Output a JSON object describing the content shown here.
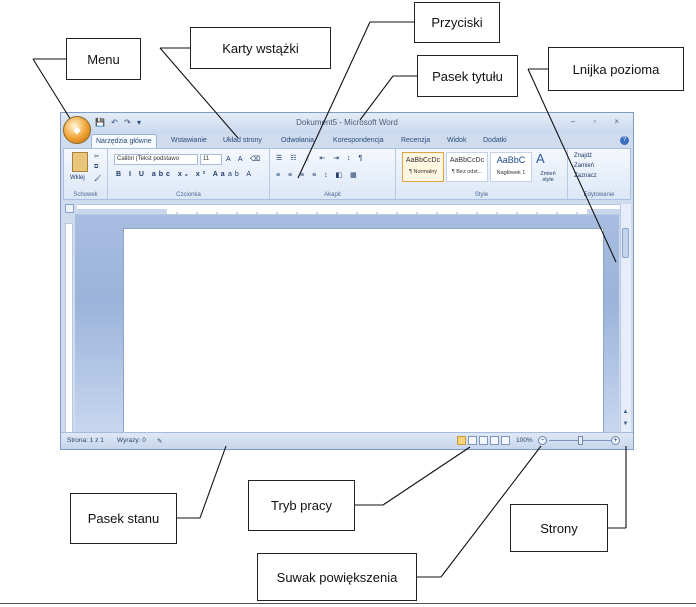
{
  "callouts": {
    "menu": "Menu",
    "karty": "Karty wstążki",
    "przyciski": "Przyciski",
    "pasek_tytulu": "Pasek tytułu",
    "linijka": "Lnijka pozioma",
    "pasek_stanu": "Pasek stanu",
    "tryb_pracy": "Tryb pracy",
    "suwak": "Suwak powiększenia",
    "strony": "Strony"
  },
  "word": {
    "title": "Dokument5 - Microsoft Word",
    "window_controls": "–  ▫  ×",
    "tabs": [
      "Narzędzia główne",
      "Wstawianie",
      "Układ strony",
      "Odwołania",
      "Korespondencja",
      "Recenzja",
      "Widok",
      "Dodatki"
    ],
    "groups": {
      "schowek": "Schowek",
      "czcionka": "Czcionka",
      "akapit": "Akapit",
      "style": "Style",
      "edytowanie": "Edytowanie"
    },
    "paste": "Wklej",
    "font_name": "Calibri (Tekst podstawo",
    "font_size": "11",
    "styles": [
      {
        "sample": "AaBbCcDc",
        "name": "¶ Normalny"
      },
      {
        "sample": "AaBbCcDc",
        "name": "¶ Bez odst..."
      },
      {
        "sample": "AaBbC",
        "name": "Nagłówek 1"
      }
    ],
    "change_styles": "Zmień style",
    "edit_find": "Znajdź",
    "edit_replace": "Zamień",
    "edit_select": "Zaznacz",
    "status_page": "Strona: 1 z 1",
    "status_words": "Wyrazy: 0",
    "zoom": "100%"
  },
  "colors": {
    "window_border": "#7f9ac3",
    "ribbon_bg": "#dce7f6",
    "document_bg": "#9bb3da",
    "office_orb": "#f0a030"
  }
}
